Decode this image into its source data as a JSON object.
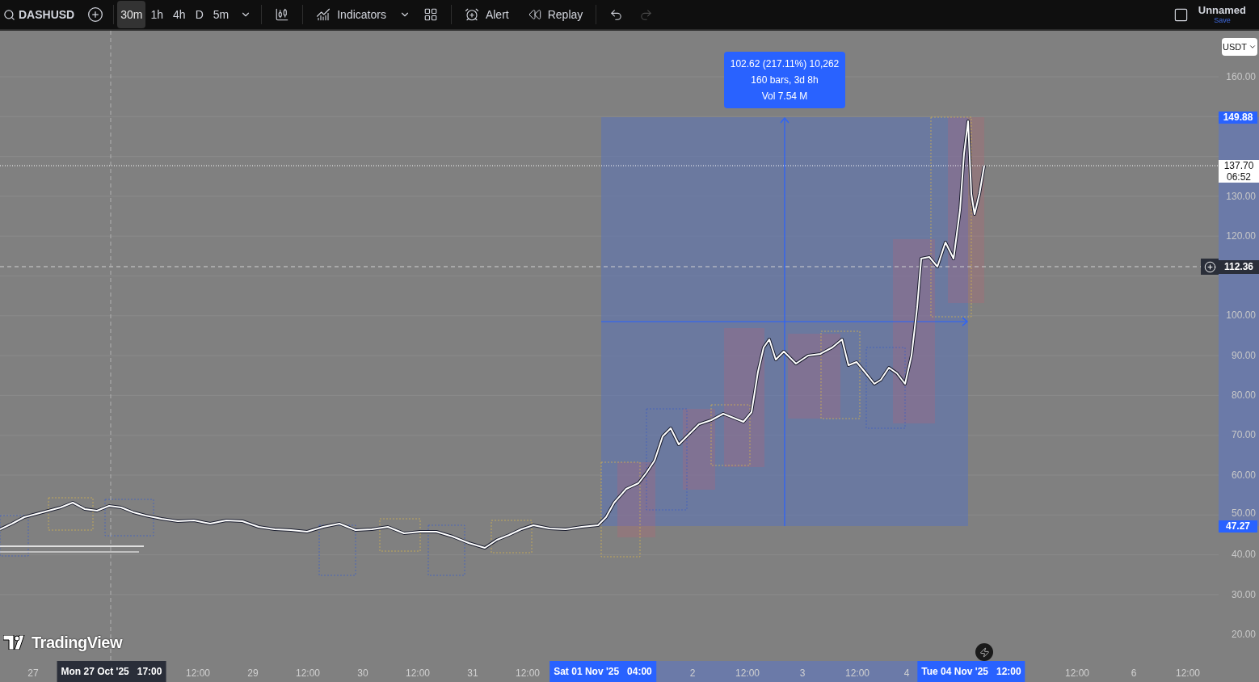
{
  "toolbar": {
    "symbol": "DASHUSD",
    "intervals": [
      {
        "label": "30m",
        "selected": true
      },
      {
        "label": "1h",
        "selected": false
      },
      {
        "label": "4h",
        "selected": false
      },
      {
        "label": "D",
        "selected": false
      },
      {
        "label": "5m",
        "selected": false
      }
    ],
    "indicators": "Indicators",
    "alert": "Alert",
    "replay": "Replay",
    "redo": {
      "disabled": true
    },
    "layout_name": "Unnamed",
    "save": "Save"
  },
  "chart": {
    "currency": "USDT",
    "measure": {
      "lines": [
        "102.62 (217.11%) 10,262",
        "160 bars, 3d 8h",
        "Vol 7.54 M"
      ]
    },
    "price_ticks": [
      "160.00",
      "130.00",
      "120.00",
      "100.00",
      "90.00",
      "80.00",
      "70.00",
      "60.00",
      "50.00",
      "40.00",
      "30.00",
      "20.00"
    ],
    "price_labels": [
      {
        "kind": "range",
        "text": "149.88"
      },
      {
        "kind": "last",
        "text": "137.70",
        "countdown": "06:52"
      },
      {
        "kind": "crosshair",
        "text": "112.36"
      },
      {
        "kind": "range",
        "text": "47.27"
      }
    ],
    "logo": "TradingView"
  },
  "time_axis": [
    {
      "kind": "tick",
      "text": "27"
    },
    {
      "kind": "crosshair",
      "text": "Mon 27 Oct '25",
      "time": "17:00"
    },
    {
      "kind": "tick",
      "text": "12:00"
    },
    {
      "kind": "tick",
      "text": "29"
    },
    {
      "kind": "tick",
      "text": "12:00"
    },
    {
      "kind": "tick",
      "text": "30"
    },
    {
      "kind": "tick",
      "text": "12:00"
    },
    {
      "kind": "tick",
      "text": "31"
    },
    {
      "kind": "tick",
      "text": "12:00"
    },
    {
      "kind": "range",
      "text": "Sat 01 Nov '25",
      "time": "04:00"
    },
    {
      "kind": "tick",
      "text": "2"
    },
    {
      "kind": "tick",
      "text": "12:00"
    },
    {
      "kind": "tick",
      "text": "3"
    },
    {
      "kind": "tick",
      "text": "12:00"
    },
    {
      "kind": "tick",
      "text": "4"
    },
    {
      "kind": "range",
      "text": "Tue 04 Nov '25",
      "time": "12:00"
    },
    {
      "kind": "tick",
      "text": "12:00"
    },
    {
      "kind": "tick",
      "text": "6"
    },
    {
      "kind": "tick",
      "text": "12:00"
    }
  ]
}
